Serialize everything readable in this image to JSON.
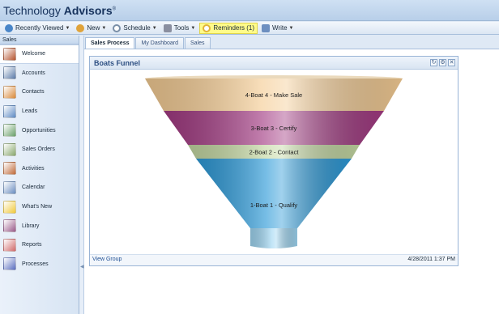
{
  "app": {
    "logo_light": "Technology ",
    "logo_bold": "Advisors",
    "logo_mark": "®"
  },
  "toolbar": {
    "items": [
      {
        "label": "Recently Viewed",
        "icon": "history-icon",
        "color": "#4a86c8"
      },
      {
        "label": "New",
        "icon": "new-person-icon",
        "color": "#e0a33a"
      },
      {
        "label": "Schedule",
        "icon": "clock-icon",
        "color": "#7a8fa8"
      },
      {
        "label": "Tools",
        "icon": "tools-icon",
        "color": "#8a8fa0"
      },
      {
        "label": "Reminders (1)",
        "icon": "alarm-clock-icon",
        "color": "#e1b43a"
      },
      {
        "label": "Write",
        "icon": "pencil-icon",
        "color": "#6d8fc0"
      }
    ]
  },
  "sidebar": {
    "title": "Sales",
    "items": [
      {
        "label": "Welcome",
        "icon": "home-icon",
        "color": "#b5532e"
      },
      {
        "label": "Accounts",
        "icon": "building-icon",
        "color": "#5a7aa8"
      },
      {
        "label": "Contacts",
        "icon": "contacts-icon",
        "color": "#d98a3a"
      },
      {
        "label": "Leads",
        "icon": "leads-icon",
        "color": "#5d8ac4"
      },
      {
        "label": "Opportunities",
        "icon": "opportunities-icon",
        "color": "#6aa06a"
      },
      {
        "label": "Sales Orders",
        "icon": "sales-orders-icon",
        "color": "#8aa86e"
      },
      {
        "label": "Activities",
        "icon": "clipboard-icon",
        "color": "#c06a3a"
      },
      {
        "label": "Calendar",
        "icon": "calendar-icon",
        "color": "#6a8ec0"
      },
      {
        "label": "What's New",
        "icon": "lightbulb-icon",
        "color": "#f0c93a"
      },
      {
        "label": "Library",
        "icon": "books-icon",
        "color": "#9a5a8a"
      },
      {
        "label": "Reports",
        "icon": "reports-icon",
        "color": "#d06a6a"
      },
      {
        "label": "Processes",
        "icon": "processes-icon",
        "color": "#5a6ec0"
      }
    ]
  },
  "tabs": [
    {
      "label": "Sales Process",
      "active": true
    },
    {
      "label": "My Dashboard",
      "active": false
    },
    {
      "label": "Sales",
      "active": false
    }
  ],
  "panel": {
    "title": "Boats Funnel",
    "buttons": [
      "refresh-icon",
      "settings-icon",
      "close-icon"
    ],
    "button_glyphs": [
      "↻",
      "⚙",
      "✕"
    ],
    "view_group": "View Group",
    "timestamp": "4/28/2011 1:37 PM"
  },
  "chart_data": {
    "type": "funnel",
    "stages": [
      {
        "label": "4-Boat 4 - Make Sale",
        "color": "#f4cc94"
      },
      {
        "label": "3-Boat 3 - Certify",
        "color": "#a23a82"
      },
      {
        "label": "2-Boat 2 - Contact",
        "color": "#c4d8a2"
      },
      {
        "label": "1-Boat 1 - Qualify",
        "color": "#2d9ad8"
      }
    ]
  }
}
